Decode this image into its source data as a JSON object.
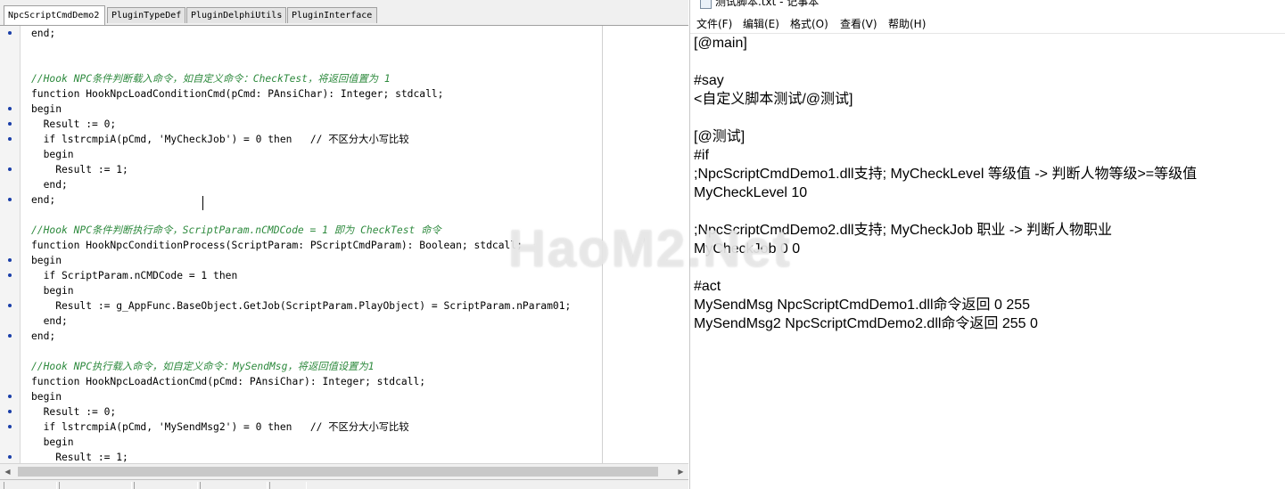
{
  "ide": {
    "tabs": [
      {
        "label": "NpcScriptCmdDemo2",
        "active": true
      },
      {
        "label": "PluginTypeDef",
        "active": false
      },
      {
        "label": "PluginDelphiUtils",
        "active": false
      },
      {
        "label": "PluginInterface",
        "active": false
      }
    ],
    "lines": [
      {
        "text": "end;",
        "bullet": true,
        "kind": "code"
      },
      {
        "text": "",
        "bullet": false,
        "kind": "code"
      },
      {
        "text": "",
        "bullet": false,
        "kind": "code"
      },
      {
        "text": "//Hook NPC条件判断载入命令，如自定义命令：CheckTest，将返回值置为 1",
        "bullet": false,
        "kind": "comment"
      },
      {
        "text": "function HookNpcLoadConditionCmd(pCmd: PAnsiChar): Integer; stdcall;",
        "bullet": false,
        "kind": "code"
      },
      {
        "text": "begin",
        "bullet": true,
        "kind": "code"
      },
      {
        "text": "  Result := 0;",
        "bullet": true,
        "kind": "code"
      },
      {
        "text": "  if lstrcmpiA(pCmd, 'MyCheckJob') = 0 then   // 不区分大小写比较",
        "bullet": true,
        "kind": "code"
      },
      {
        "text": "  begin",
        "bullet": false,
        "kind": "code"
      },
      {
        "text": "    Result := 1;",
        "bullet": true,
        "kind": "code"
      },
      {
        "text": "  end;",
        "bullet": false,
        "kind": "code"
      },
      {
        "text": "end;",
        "bullet": true,
        "kind": "code"
      },
      {
        "text": "",
        "bullet": false,
        "kind": "code"
      },
      {
        "text": "//Hook NPC条件判断执行命令，ScriptParam.nCMDCode = 1 即为 CheckTest 命令",
        "bullet": false,
        "kind": "comment"
      },
      {
        "text": "function HookNpcConditionProcess(ScriptParam: PScriptCmdParam): Boolean; stdcall;",
        "bullet": false,
        "kind": "code"
      },
      {
        "text": "begin",
        "bullet": true,
        "kind": "code"
      },
      {
        "text": "  if ScriptParam.nCMDCode = 1 then",
        "bullet": true,
        "kind": "code"
      },
      {
        "text": "  begin",
        "bullet": false,
        "kind": "code"
      },
      {
        "text": "    Result := g_AppFunc.BaseObject.GetJob(ScriptParam.PlayObject) = ScriptParam.nParam01;",
        "bullet": true,
        "kind": "code"
      },
      {
        "text": "  end;",
        "bullet": false,
        "kind": "code"
      },
      {
        "text": "end;",
        "bullet": true,
        "kind": "code"
      },
      {
        "text": "",
        "bullet": false,
        "kind": "code"
      },
      {
        "text": "//Hook NPC执行载入命令，如自定义命令：MySendMsg，将返回值设置为1",
        "bullet": false,
        "kind": "comment"
      },
      {
        "text": "function HookNpcLoadActionCmd(pCmd: PAnsiChar): Integer; stdcall;",
        "bullet": false,
        "kind": "code"
      },
      {
        "text": "begin",
        "bullet": true,
        "kind": "code"
      },
      {
        "text": "  Result := 0;",
        "bullet": true,
        "kind": "code"
      },
      {
        "text": "  if lstrcmpiA(pCmd, 'MySendMsg2') = 0 then   // 不区分大小写比较",
        "bullet": true,
        "kind": "code"
      },
      {
        "text": "  begin",
        "bullet": false,
        "kind": "code"
      },
      {
        "text": "    Result := 1;",
        "bullet": true,
        "kind": "code"
      }
    ]
  },
  "notepad": {
    "title": "测试脚本.txt - 记事本",
    "menu": [
      "文件(F)",
      "编辑(E)",
      "格式(O)",
      "查看(V)",
      "帮助(H)"
    ],
    "lines": [
      "[@main]",
      "",
      "#say",
      "<自定义脚本测试/@测试]",
      "",
      "[@测试]",
      "#if",
      ";NpcScriptCmdDemo1.dll支持; MyCheckLevel 等级值 -> 判断人物等级>=等级值",
      "MyCheckLevel 10",
      "",
      ";NpcScriptCmdDemo2.dll支持; MyCheckJob 职业 -> 判断人物职业",
      "MyCheckJob 0 0",
      "",
      "#act",
      "MySendMsg NpcScriptCmdDemo1.dll命令返回 0 255",
      "MySendMsg2 NpcScriptCmdDemo2.dll命令返回 255 0"
    ]
  },
  "watermark": "HaoM2.Net"
}
